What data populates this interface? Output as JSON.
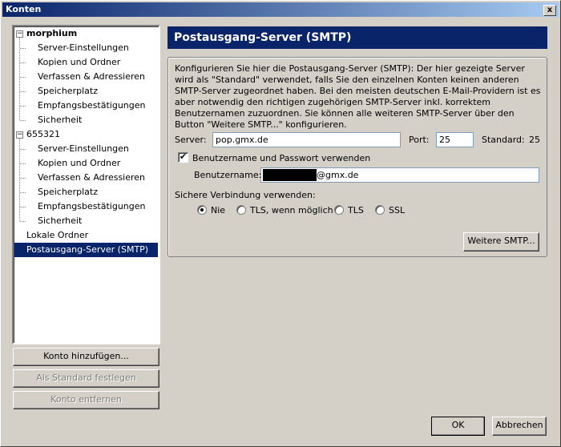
{
  "window": {
    "title": "Konten",
    "close_glyph": "x"
  },
  "tree": {
    "accounts": [
      {
        "name": "morphium",
        "expander": "−",
        "children": [
          "Server-Einstellungen",
          "Kopien und Ordner",
          "Verfassen & Adressieren",
          "Speicherplatz",
          "Empfangsbestätigungen",
          "Sicherheit"
        ]
      },
      {
        "name": "655321",
        "expander": "−",
        "children": [
          "Server-Einstellungen",
          "Kopien und Ordner",
          "Verfassen & Adressieren",
          "Speicherplatz",
          "Empfangsbestätigungen",
          "Sicherheit"
        ]
      }
    ],
    "local_folders": "Lokale Ordner",
    "smtp": "Postausgang-Server (SMTP)"
  },
  "left_buttons": {
    "add_account": "Konto hinzufügen...",
    "set_default": "Als Standard festlegen",
    "remove_account": "Konto entfernen"
  },
  "panel": {
    "title": "Postausgang-Server (SMTP)",
    "description": "Konfigurieren Sie hier die Postausgang-Server (SMTP): Der hier gezeigte Server wird als \"Standard\" verwendet, falls Sie den einzelnen Konten keinen anderen SMTP-Server zugeordnet haben. Bei den meisten deutschen E-Mail-Providern ist es aber notwendig den richtigen zugehörigen SMTP-Server inkl. korrektem Benutzernamen zuzuordnen. Sie können alle weiteren SMTP-Server über den Button \"Weitere SMTP...\" konfigurieren.",
    "server_label": "Server:",
    "server_value": "pop.gmx.de",
    "port_label": "Port:",
    "port_value": "25",
    "standard_label": "Standard:",
    "standard_value": "25",
    "auth_checkbox_label": "Benutzername und Passwort verwenden",
    "auth_checked": true,
    "username_label": "Benutzername:",
    "username_suffix": "@gmx.de",
    "secure_label": "Sichere Verbindung verwenden:",
    "secure_options": [
      "Nie",
      "TLS, wenn möglich",
      "TLS",
      "SSL"
    ],
    "secure_selected": "Nie",
    "more_smtp_button": "Weitere SMTP..."
  },
  "footer": {
    "ok": "OK",
    "cancel": "Abbrechen"
  }
}
